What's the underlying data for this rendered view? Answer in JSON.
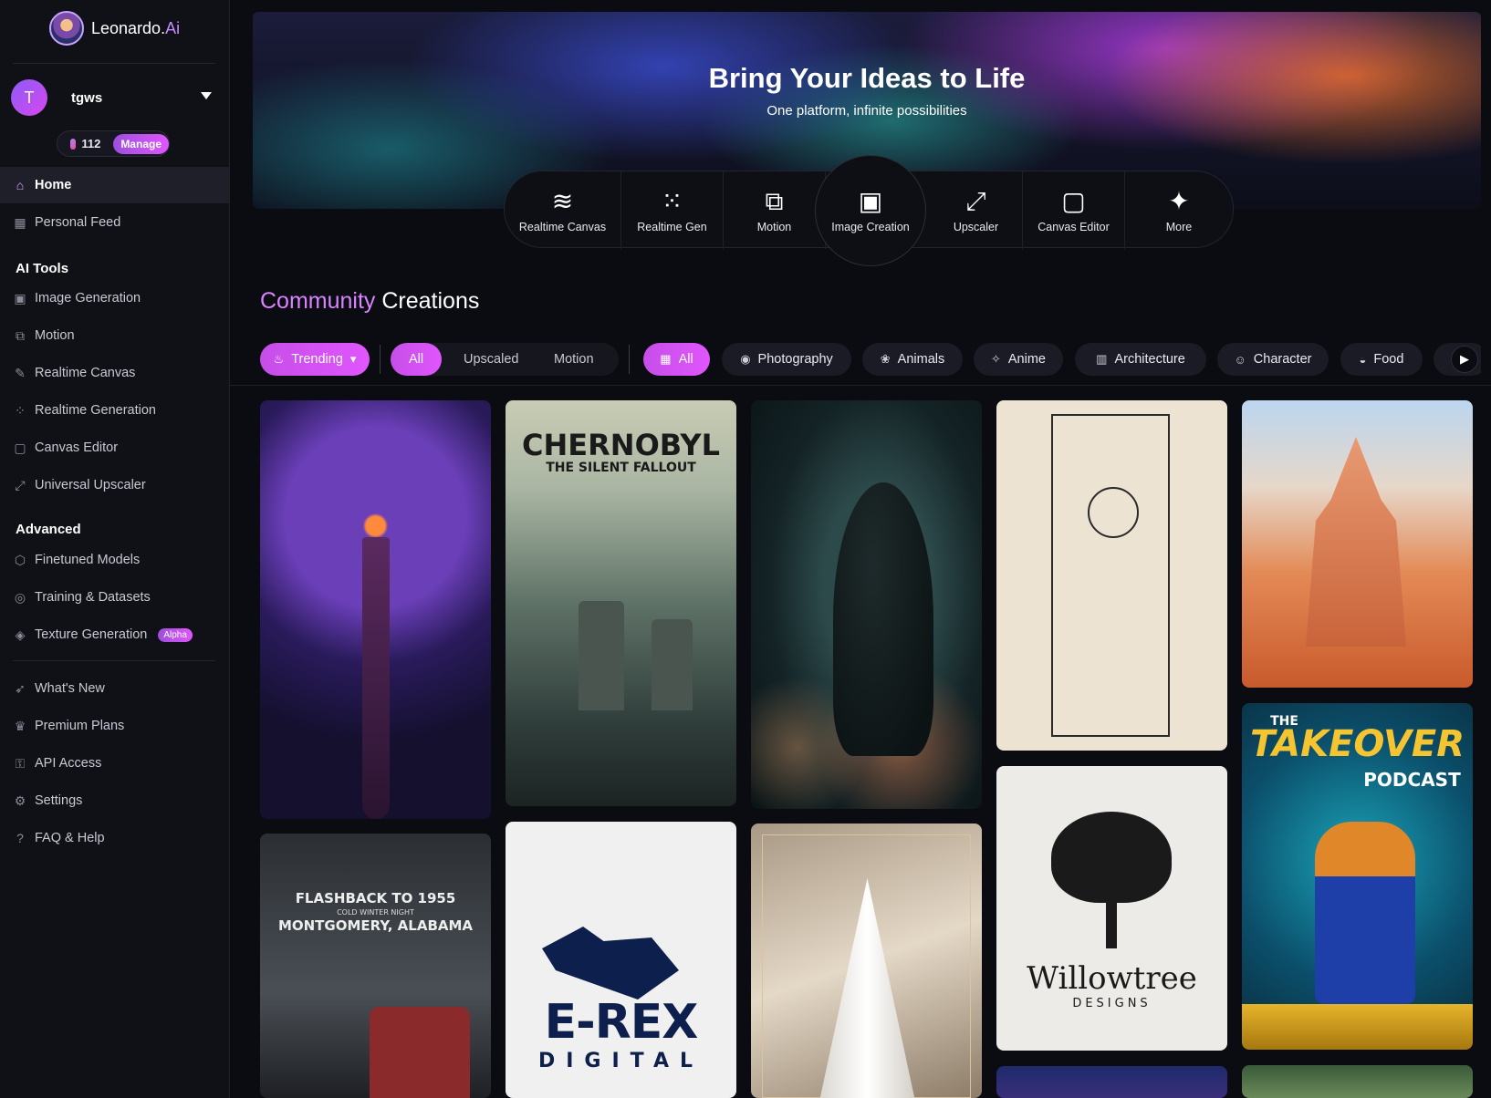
{
  "brand": {
    "name": "Leonardo.",
    "suffix": "Ai"
  },
  "user": {
    "initial": "T",
    "name": "tgws",
    "credits": "112",
    "manage_label": "Manage"
  },
  "nav": {
    "top": [
      {
        "label": "Home",
        "icon": "home-icon"
      },
      {
        "label": "Personal Feed",
        "icon": "grid-icon"
      }
    ],
    "ai_tools_title": "AI Tools",
    "ai_tools": [
      {
        "label": "Image Generation",
        "icon": "image-icon"
      },
      {
        "label": "Motion",
        "icon": "film-icon"
      },
      {
        "label": "Realtime Canvas",
        "icon": "brush-icon"
      },
      {
        "label": "Realtime Generation",
        "icon": "dots-grid-icon"
      },
      {
        "label": "Canvas Editor",
        "icon": "frame-icon"
      },
      {
        "label": "Universal Upscaler",
        "icon": "upscale-icon"
      }
    ],
    "advanced_title": "Advanced",
    "advanced": [
      {
        "label": "Finetuned Models",
        "icon": "cube-icon"
      },
      {
        "label": "Training & Datasets",
        "icon": "dataset-icon"
      },
      {
        "label": "Texture Generation",
        "icon": "texture-icon",
        "badge": "Alpha"
      }
    ],
    "bottom": [
      {
        "label": "What's New",
        "icon": "rocket-icon"
      },
      {
        "label": "Premium Plans",
        "icon": "crown-icon"
      },
      {
        "label": "API Access",
        "icon": "key-icon"
      },
      {
        "label": "Settings",
        "icon": "gear-icon"
      },
      {
        "label": "FAQ & Help",
        "icon": "help-icon"
      }
    ]
  },
  "hero": {
    "title": "Bring Your Ideas to Life",
    "subtitle": "One platform, infinite possibilities",
    "tools": [
      {
        "label": "Realtime Canvas",
        "icon": "realtime-canvas-icon"
      },
      {
        "label": "Realtime Gen",
        "icon": "realtime-gen-icon"
      },
      {
        "label": "Motion",
        "icon": "motion-icon"
      },
      {
        "label": "Image Creation",
        "icon": "image-creation-icon"
      },
      {
        "label": "Upscaler",
        "icon": "upscaler-icon"
      },
      {
        "label": "Canvas Editor",
        "icon": "canvas-editor-icon"
      },
      {
        "label": "More",
        "icon": "sparkles-icon"
      }
    ]
  },
  "community": {
    "title_part1": "Community",
    "title_part2": "Creations",
    "sort_label": "Trending",
    "types": [
      "All",
      "Upscaled",
      "Motion"
    ],
    "categories": [
      "All",
      "Photography",
      "Animals",
      "Anime",
      "Architecture",
      "Character",
      "Food"
    ]
  },
  "gallery": {
    "cards": [
      {
        "title": "CHERNOBYL",
        "subtitle": "THE SILENT FALLOUT"
      },
      {
        "title": "FLASHBACK TO 1955",
        "subtitle": "COLD WINTER NIGHT",
        "caption": "MONTGOMERY, ALABAMA"
      },
      {
        "title": "E-REX",
        "subtitle": "DIGITAL"
      },
      {
        "title": "Willowtree",
        "subtitle": "DESIGNS"
      },
      {
        "title": "THE",
        "subtitle": "TAKEOVER",
        "caption": "PODCAST"
      }
    ]
  }
}
